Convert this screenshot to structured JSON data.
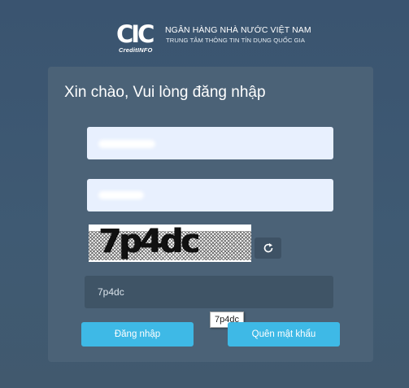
{
  "header": {
    "logo_text": "CIC",
    "logo_subtitle": "CreditINFO",
    "bank_name": "NGÂN HÀNG NHÀ NƯỚC VIỆT NAM",
    "bank_subtitle": "TRUNG TÂM THÔNG TIN TÍN DỤNG QUỐC GIA"
  },
  "form": {
    "title": "Xin chào, Vui lòng đăng nhập",
    "username_value": "",
    "password_value": "",
    "captcha_image_text": "7p4dc",
    "captcha_input_value": "7p4dc",
    "autocomplete_tooltip": "7p4dc",
    "login_button": "Đăng nhập",
    "forgot_button": "Quên mật khẩu"
  },
  "icons": {
    "refresh": "refresh-icon"
  },
  "colors": {
    "background": "#3a5470",
    "panel": "#4b6277",
    "button": "#3eb9e6",
    "field": "#e8f0fe"
  }
}
